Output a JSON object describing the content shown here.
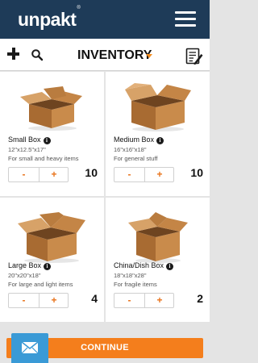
{
  "header": {
    "logo": "unpakt",
    "logo_mark": "®",
    "menu_icon": "hamburger-menu-icon"
  },
  "toolbar": {
    "add_icon": "plus-icon",
    "search_icon": "search-icon",
    "title": "INVENTORY",
    "dropdown_icon": "caret-down-icon",
    "notes_icon": "clipboard-edit-icon"
  },
  "items": [
    {
      "name": "Small Box",
      "dims": "12\"x12.5\"x17\"",
      "desc": "For small and heavy items",
      "minus": "-",
      "plus": "+",
      "qty": "10"
    },
    {
      "name": "Medium Box",
      "dims": "16\"x16\"x18\"",
      "desc": "For general stuff",
      "minus": "-",
      "plus": "+",
      "qty": "10"
    },
    {
      "name": "Large Box",
      "dims": "20\"x20\"x18\"",
      "desc": "For large and light items",
      "minus": "-",
      "plus": "+",
      "qty": "4"
    },
    {
      "name": "China/Dish Box",
      "dims": "18\"x18\"x28\"",
      "desc": "For fragile items",
      "minus": "-",
      "plus": "+",
      "qty": "2"
    }
  ],
  "info_glyph": "i",
  "footer": {
    "continue_label": "CONTINUE",
    "mail_icon": "envelope-icon"
  },
  "colors": {
    "header_bg": "#1e3b58",
    "accent": "#f47e1c",
    "mail_bg": "#3a9ad6"
  }
}
